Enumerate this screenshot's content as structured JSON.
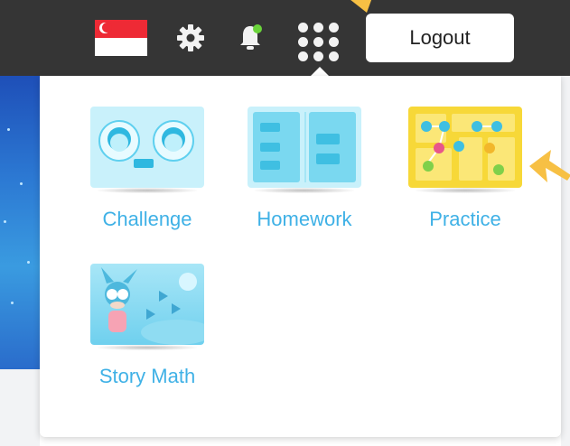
{
  "header": {
    "flag_icon": "singapore-flag-icon",
    "settings_icon": "gear-icon",
    "notifications_icon": "bell-icon",
    "apps_icon": "grid-dots-icon",
    "logout_label": "Logout"
  },
  "apps_menu": {
    "items": [
      {
        "label": "Challenge",
        "icon": "challenge-thumbnail"
      },
      {
        "label": "Homework",
        "icon": "homework-thumbnail"
      },
      {
        "label": "Practice",
        "icon": "practice-thumbnail"
      },
      {
        "label": "Story Math",
        "icon": "story-math-thumbnail"
      }
    ]
  },
  "colors": {
    "topbar": "#353535",
    "label": "#3fb1e6",
    "arrow": "#f7c044",
    "practice_bg": "#f7d838",
    "tile_bg": "#bfeefb"
  }
}
